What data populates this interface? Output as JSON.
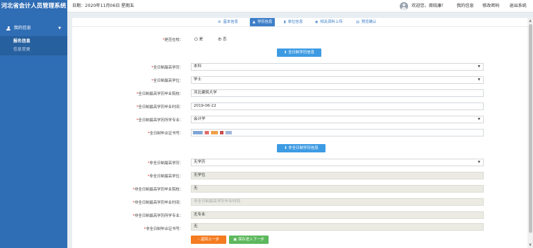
{
  "header": {
    "app_title": "河北省会计人员管理系统",
    "date_text": "日期：2020年11月06日 星期五",
    "welcome": "欢迎您，周晓康！",
    "links": [
      "我的信息",
      "修改密码",
      "退出系统"
    ]
  },
  "sidebar": {
    "section_label": "我的信息",
    "items": [
      {
        "label": "报名信息",
        "active": true
      },
      {
        "label": "信息变更",
        "active": false
      }
    ]
  },
  "tabs": [
    {
      "label": "基本信息",
      "icon": "gear-icon",
      "active": false
    },
    {
      "label": "学历信息",
      "icon": "mortarboard-icon",
      "active": true
    },
    {
      "label": "单位信息",
      "icon": "building-icon",
      "active": false
    },
    {
      "label": "相关资料上传",
      "icon": "eye-icon",
      "active": false
    },
    {
      "label": "预览确认",
      "icon": "document-icon",
      "active": false
    }
  ],
  "form": {
    "in_school": {
      "label": "是否在校：",
      "options": [
        {
          "label": "是",
          "checked": false
        },
        {
          "label": "否",
          "checked": true
        }
      ]
    },
    "fulltime_section_button": "全日制学历信息",
    "fulltime_fields": [
      {
        "label": "全日制最高学历：",
        "value": "本科",
        "type": "select"
      },
      {
        "label": "全日制最高学位：",
        "value": "学士",
        "type": "select"
      },
      {
        "label": "全日制最高学历毕业院校：",
        "value": "河北建筑大学",
        "type": "text"
      },
      {
        "label": "全日制最高学历毕业时间：",
        "value": "2019-06-22",
        "type": "text"
      },
      {
        "label": "全日制最高学历所学专业：",
        "value": "会计学",
        "type": "select"
      },
      {
        "label": "全日制毕业证书号：",
        "value": "",
        "type": "redacted"
      }
    ],
    "parttime_section_button": "非全日制学历信息",
    "parttime_fields": [
      {
        "label": "非全日制最高学历：",
        "value": "无学历",
        "type": "select"
      },
      {
        "label": "非全日制最高学位：",
        "value": "无学位",
        "type": "disabled"
      },
      {
        "label": "非全日制最高学历毕业院校：",
        "value": "无",
        "type": "disabled"
      },
      {
        "label": "非全日制最高学历毕业时间：",
        "value": "非全日制最高学历毕业时间",
        "type": "placeholder"
      },
      {
        "label": "非全日制最高学历所学专业：",
        "value": "无专业",
        "type": "disabled"
      },
      {
        "label": "非全日制毕业证书号：",
        "value": "无",
        "type": "disabled"
      }
    ],
    "prev_button": "返回上一步",
    "next_button": "保存进入下一步"
  },
  "colors": {
    "sidebar_bg": "#2f6db5",
    "tab_active": "#3e7fc8",
    "section_button": "#3d9be3",
    "prev_button": "#f47b20",
    "next_button": "#5cb85c",
    "required_mark": "#e02020"
  }
}
